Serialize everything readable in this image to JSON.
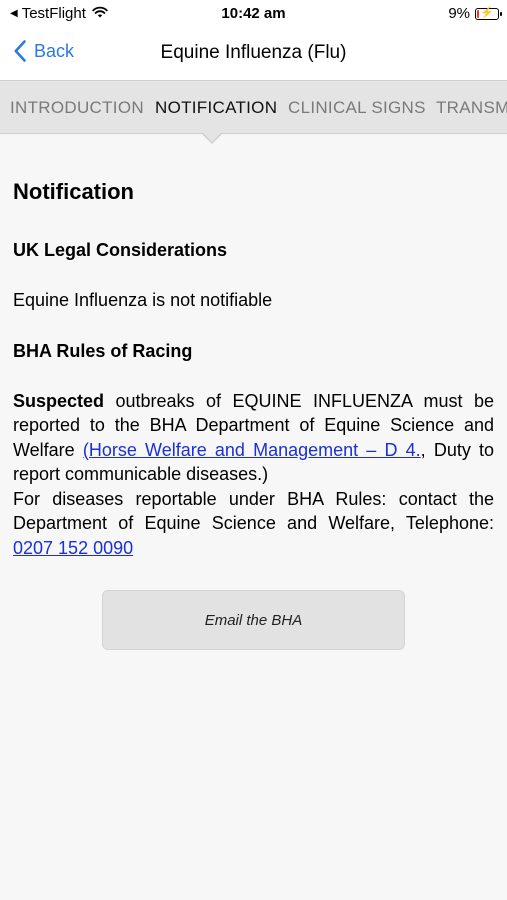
{
  "status": {
    "carrier": "TestFlight",
    "time": "10:42 am",
    "battery": "9%"
  },
  "nav": {
    "back_label": "Back",
    "title": "Equine Influenza (Flu)"
  },
  "tabs": [
    {
      "label": "INTRODUCTION"
    },
    {
      "label": "NOTIFICATION"
    },
    {
      "label": "CLINICAL SIGNS"
    },
    {
      "label": "TRANSM"
    }
  ],
  "content": {
    "heading": "Notification",
    "uk_heading": "UK Legal Considerations",
    "uk_text": "Equine Influenza is not notifiable",
    "bha_heading": "BHA Rules of Racing",
    "para1_bold": "Suspected",
    "para1_text": " outbreaks of EQUINE INFLUENZA must be reported to the BHA Department of Equine Science and Welfare ",
    "para1_link": "(Horse Welfare and Management – D 4.",
    "para1_tail": ", Duty to report communicable diseases.)",
    "para2_text": "For diseases reportable under BHA Rules: contact the Department of Equine Science and Welfare, Telephone: ",
    "phone_link": "0207 152 0090"
  },
  "email_button_label": "Email the BHA"
}
